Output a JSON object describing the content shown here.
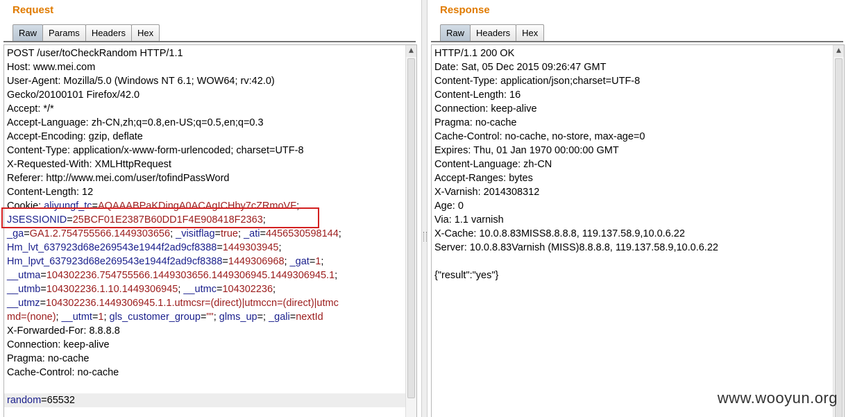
{
  "colors": {
    "title": "#e07b00",
    "key": "#1a1f8c",
    "value": "#9b1c1c",
    "highlight_border": "#d32020"
  },
  "request": {
    "title": "Request",
    "tabs": [
      {
        "label": "Raw",
        "active": true
      },
      {
        "label": "Params",
        "active": false
      },
      {
        "label": "Headers",
        "active": false
      },
      {
        "label": "Hex",
        "active": false
      }
    ],
    "lines": [
      "POST /user/toCheckRandom HTTP/1.1",
      "Host: www.mei.com",
      "User-Agent: Mozilla/5.0 (Windows NT 6.1; WOW64; rv:42.0)",
      "Gecko/20100101 Firefox/42.0",
      "Accept: */*",
      "Accept-Language: zh-CN,zh;q=0.8,en-US;q=0.5,en;q=0.3",
      "Accept-Encoding: gzip, deflate",
      "Content-Type: application/x-www-form-urlencoded; charset=UTF-8",
      "X-Requested-With: XMLHttpRequest",
      "Referer: http://www.mei.com/user/tofindPassWord",
      "Content-Length: 12"
    ],
    "cookie_label": "Cookie: ",
    "cookie_rows": [
      [
        [
          "aliyungf_tc",
          "AQAAABPaKDingA0ACAgICHby7cZRmoVF",
          ";"
        ]
      ],
      [
        [
          "JSESSIONID",
          "25BCF01E2387B60DD1F4E908418F2363",
          ";"
        ]
      ],
      [
        [
          "_ga",
          "GA1.2.754755566.1449303656",
          "; "
        ],
        [
          "_visitflag",
          "true",
          "; "
        ],
        [
          "_ati",
          "4456530598144",
          ";"
        ]
      ],
      [
        [
          "Hm_lvt_637923d68e269543e1944f2ad9cf8388",
          "1449303945",
          ";"
        ]
      ],
      [
        [
          "Hm_lpvt_637923d68e269543e1944f2ad9cf8388",
          "1449306968",
          "; "
        ],
        [
          "_gat",
          "1",
          ";"
        ]
      ],
      [
        [
          "__utma",
          "104302236.754755566.1449303656.1449306945.1449306945.1",
          ";"
        ]
      ],
      [
        [
          "__utmb",
          "104302236.1.10.1449306945",
          "; "
        ],
        [
          "__utmc",
          "104302236",
          ";"
        ]
      ],
      [
        [
          "__utmz",
          "104302236.1449306945.1.1.utmcsr=(direct)|utmccn=(direct)|utmc",
          ""
        ]
      ],
      [
        [
          "",
          "md=(none)",
          "; "
        ],
        [
          "__utmt",
          "1",
          "; "
        ],
        [
          "gls_customer_group",
          "\"\"",
          "; "
        ],
        [
          "glms_up",
          "",
          "; "
        ],
        [
          "_gali",
          "nextId",
          ""
        ]
      ]
    ],
    "after_lines": [
      "X-Forwarded-For: 8.8.8.8",
      "Connection: keep-alive",
      "Pragma: no-cache",
      "Cache-Control: no-cache"
    ],
    "param": {
      "key": "random",
      "value": "65532"
    }
  },
  "response": {
    "title": "Response",
    "tabs": [
      {
        "label": "Raw",
        "active": true
      },
      {
        "label": "Headers",
        "active": false
      },
      {
        "label": "Hex",
        "active": false
      }
    ],
    "lines": [
      "HTTP/1.1 200 OK",
      "Date: Sat, 05 Dec 2015 09:26:47 GMT",
      "Content-Type: application/json;charset=UTF-8",
      "Content-Length: 16",
      "Connection: keep-alive",
      "Pragma: no-cache",
      "Cache-Control: no-cache, no-store, max-age=0",
      "Expires: Thu, 01 Jan 1970 00:00:00 GMT",
      "Content-Language: zh-CN",
      "Accept-Ranges: bytes",
      "X-Varnish: 2014308312",
      "Age: 0",
      "Via: 1.1 varnish",
      "X-Cache: 10.0.8.83MISS8.8.8.8, 119.137.58.9,10.0.6.22",
      "Server: 10.0.8.83Varnish (MISS)8.8.8.8, 119.137.58.9,10.0.6.22",
      "",
      "{\"result\":\"yes\"}"
    ]
  },
  "watermark": "www.wooyun.org"
}
